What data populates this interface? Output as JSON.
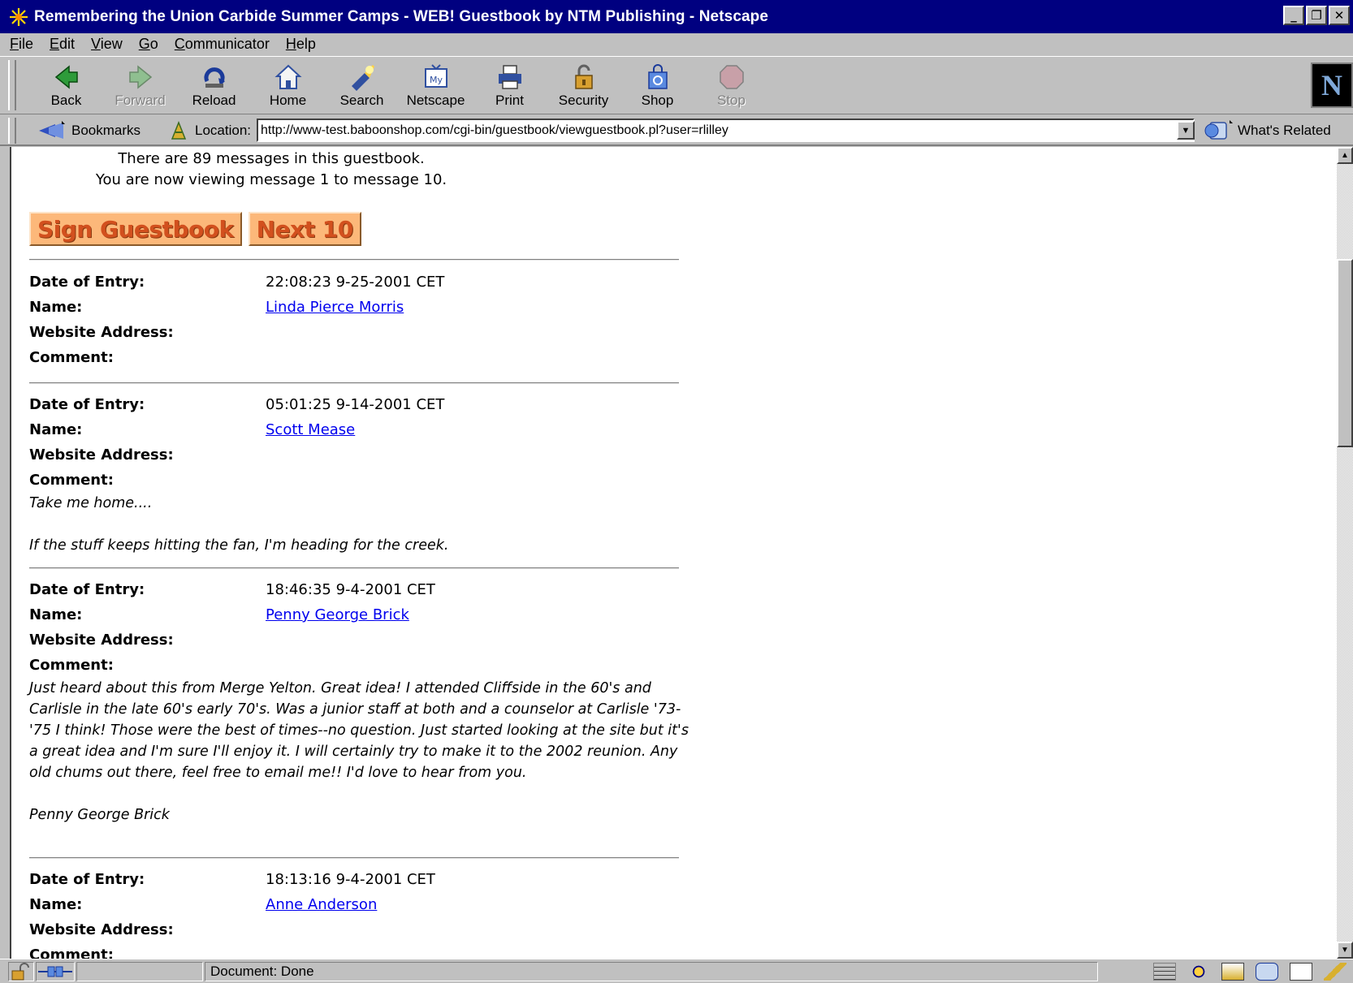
{
  "window": {
    "title": "Remembering the Union Carbide Summer Camps - WEB! Guestbook by NTM Publishing - Netscape",
    "controls": [
      "_",
      "❐",
      "✕"
    ]
  },
  "menu": [
    {
      "pre": "",
      "u": "F",
      "rest": "ile"
    },
    {
      "pre": "",
      "u": "E",
      "rest": "dit"
    },
    {
      "pre": "",
      "u": "V",
      "rest": "iew"
    },
    {
      "pre": "",
      "u": "G",
      "rest": "o"
    },
    {
      "pre": "",
      "u": "C",
      "rest": "ommunicator"
    },
    {
      "pre": "",
      "u": "H",
      "rest": "elp"
    }
  ],
  "toolbar": {
    "back": "Back",
    "forward": "Forward",
    "reload": "Reload",
    "home": "Home",
    "search": "Search",
    "netscape": "Netscape",
    "print": "Print",
    "security": "Security",
    "shop": "Shop",
    "stop": "Stop"
  },
  "logo_letter": "N",
  "location": {
    "bookmarks": "Bookmarks",
    "label": "Location:",
    "url": "http://www-test.baboonshop.com/cgi-bin/guestbook/viewguestbook.pl?user=rlilley",
    "related": "What's Related"
  },
  "guestbook": {
    "count_line": "There are 89 messages in this guestbook.",
    "viewing_line": "You are now viewing message 1 to message 10.",
    "sign_button": "Sign Guestbook",
    "next_button": "Next 10",
    "labels": {
      "date": "Date of Entry:",
      "name": "Name:",
      "website": "Website Address:",
      "comment": "Comment:"
    },
    "entries": [
      {
        "date": "22:08:23 9-25-2001 CET",
        "name": "Linda Pierce Morris",
        "comment": []
      },
      {
        "date": "05:01:25 9-14-2001 CET",
        "name": "Scott Mease",
        "comment": [
          "Take me home....",
          "If the stuff keeps hitting the fan, I'm heading for the creek."
        ]
      },
      {
        "date": "18:46:35 9-4-2001 CET",
        "name": "Penny George Brick",
        "comment": [
          "Just heard about this from Merge Yelton. Great idea! I attended Cliffside in the 60's and Carlisle in the late 60's early 70's. Was a junior staff at both and a counselor at Carlisle '73-'75 I think! Those were the best of times--no question. Just started looking at the site but it's a great idea and I'm sure I'll enjoy it. I will certainly try to make it to the 2002 reunion. Any old chums out there, feel free to email me!! I'd love to hear from you.",
          "Penny George Brick"
        ]
      },
      {
        "date": "18:13:16 9-4-2001 CET",
        "name": "Anne Anderson",
        "comment": []
      }
    ]
  },
  "status": {
    "text": "Document: Done"
  },
  "colors": {
    "titlebar": "#000080",
    "chrome": "#c0c0c0",
    "link": "#0000ee",
    "button_fill": "#fcb87a",
    "button_text": "#d2501e"
  }
}
